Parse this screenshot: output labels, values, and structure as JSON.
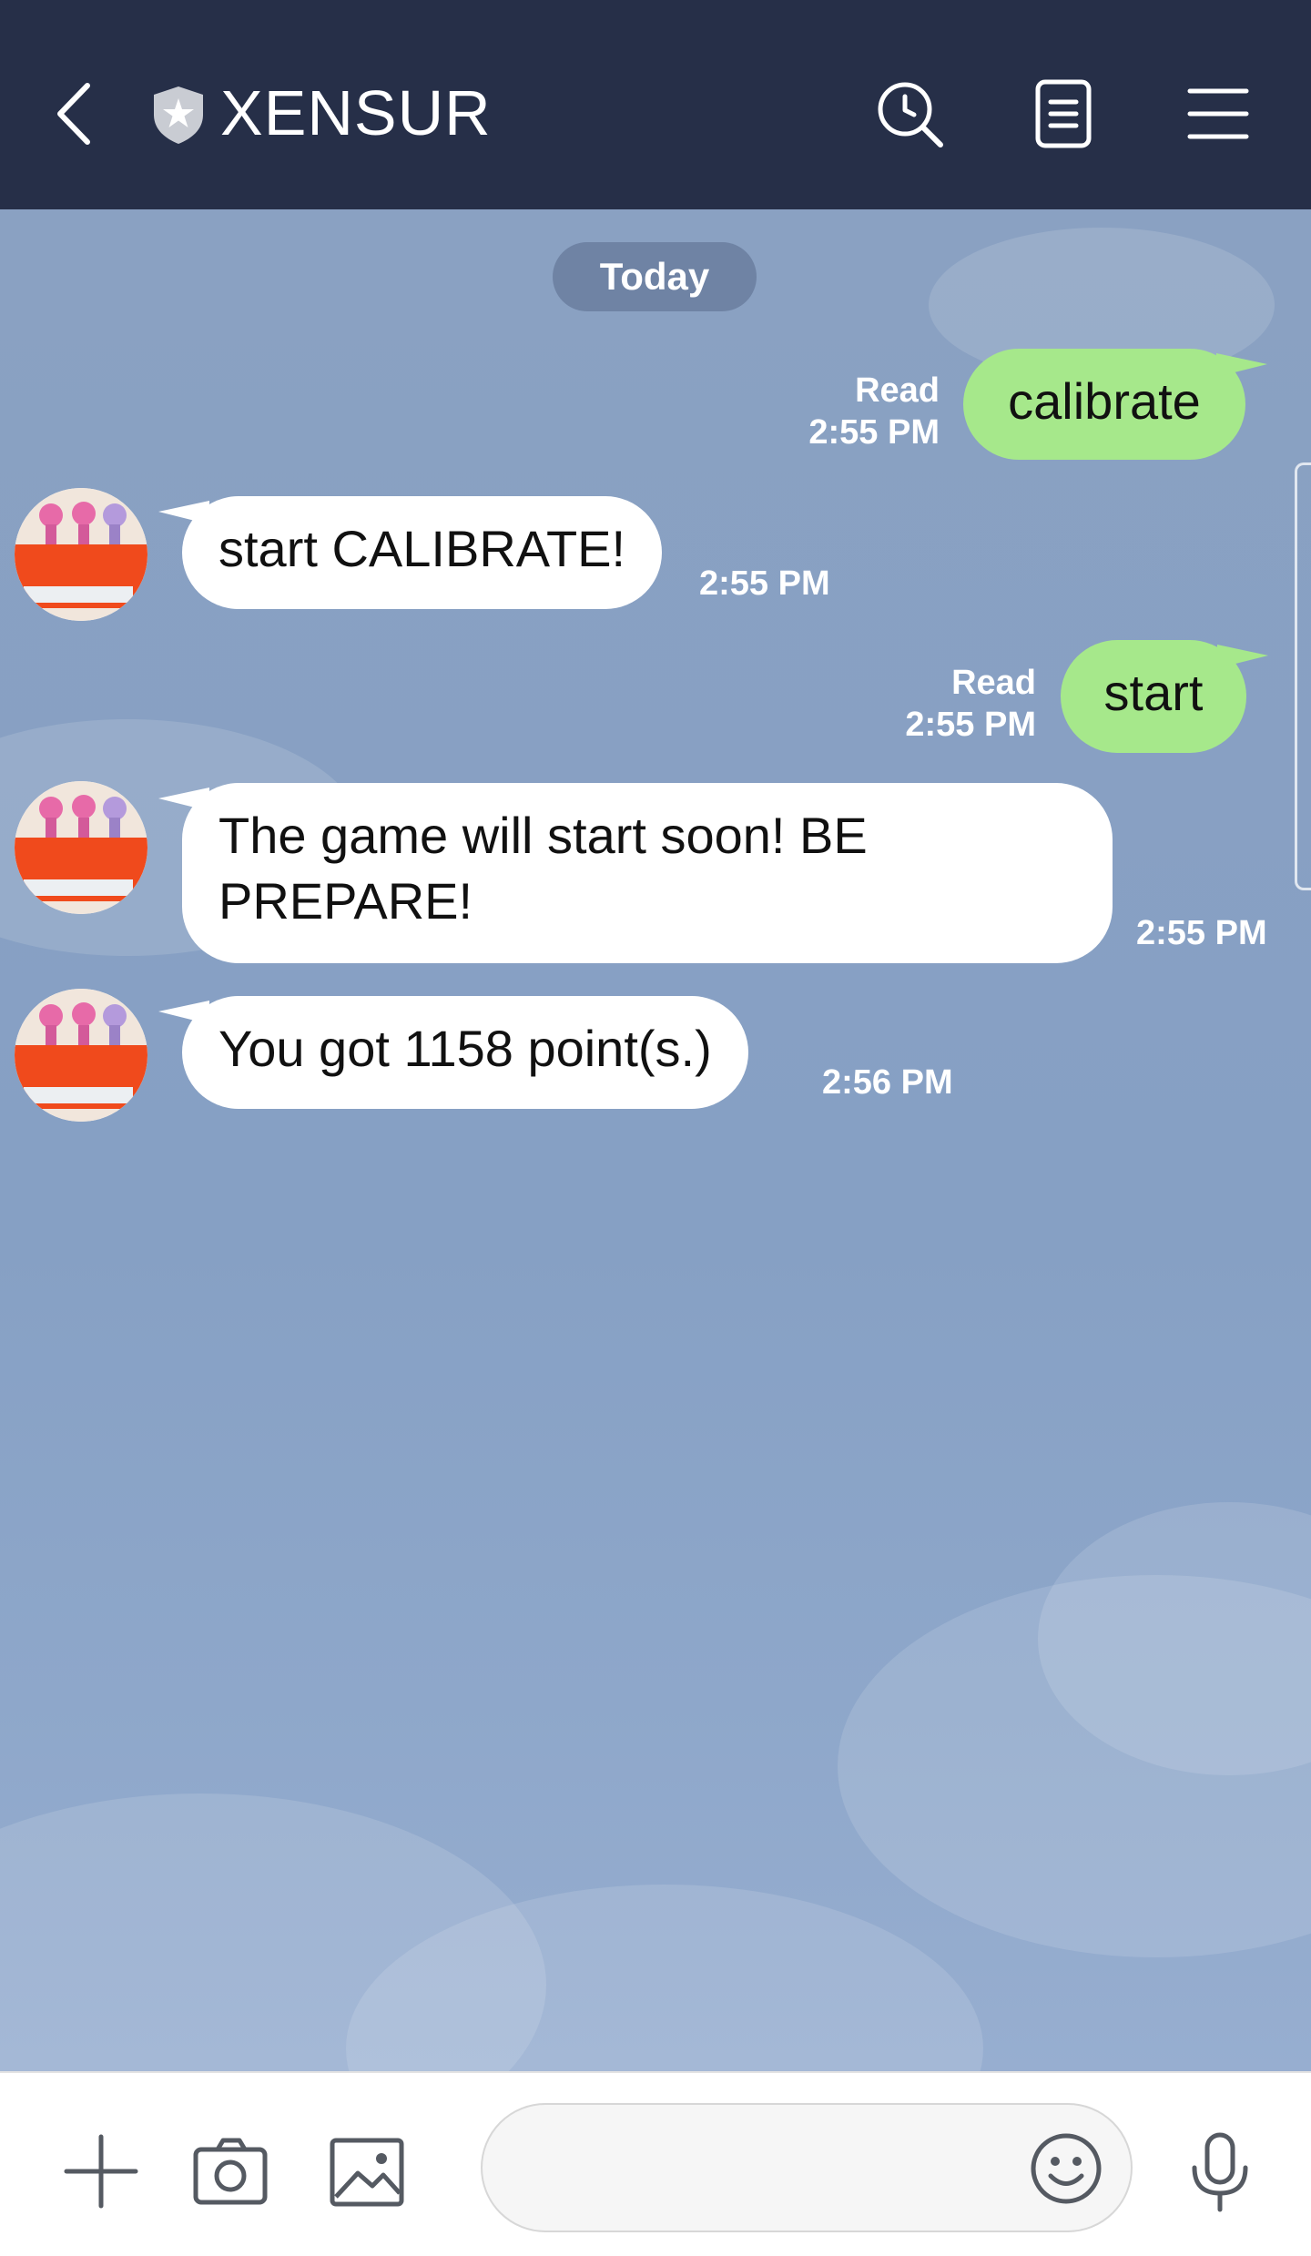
{
  "header": {
    "title": "XENSUR",
    "background_color": "#262f48",
    "icons": [
      "back-icon",
      "shield-icon",
      "search-history-icon",
      "notes-icon",
      "menu-icon"
    ]
  },
  "chat": {
    "date_label": "Today",
    "background_color": "#8aa1c2",
    "outgoing_bubble_color": "#a6e88b",
    "messages": [
      {
        "direction": "outgoing",
        "text": "calibrate",
        "read_label": "Read",
        "time": "2:55 PM"
      },
      {
        "direction": "incoming",
        "text": "start CALIBRATE!",
        "time": "2:55 PM"
      },
      {
        "direction": "outgoing",
        "text": "start",
        "read_label": "Read",
        "time": "2:55 PM"
      },
      {
        "direction": "incoming",
        "text_lines": [
          "The game will start soon! BE",
          "PREPARE!"
        ],
        "time": "2:55 PM"
      },
      {
        "direction": "incoming",
        "text": "You got 1158 point(s.)",
        "time": "2:56 PM"
      }
    ]
  },
  "footer": {
    "input_value": "",
    "input_placeholder": "",
    "icons": [
      "plus-icon",
      "camera-icon",
      "gallery-icon",
      "emoji-icon",
      "microphone-icon"
    ]
  }
}
